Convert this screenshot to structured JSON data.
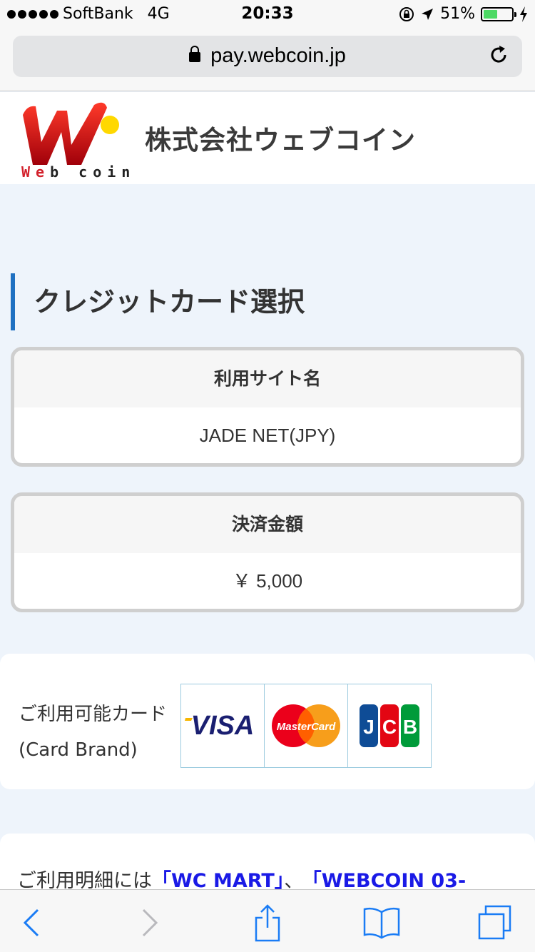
{
  "status_bar": {
    "carrier": "SoftBank",
    "network": "4G",
    "time": "20:33",
    "battery": "51%",
    "battery_level": 0.51
  },
  "browser": {
    "url": "pay.webcoin.jp"
  },
  "header": {
    "logo_text_red": "We",
    "logo_text_rest": "b coin",
    "company_name": "株式会社ウェブコイン"
  },
  "page": {
    "title": "クレジットカード選択"
  },
  "site_box": {
    "label": "利用サイト名",
    "value": "JADE NET(JPY)"
  },
  "amount_box": {
    "label": "決済金額",
    "value": "￥ 5,000"
  },
  "cards": {
    "label_jp": "ご利用可能カード",
    "label_en": "(Card Brand)",
    "brands": [
      "VISA",
      "MasterCard",
      "JCB"
    ]
  },
  "notice": {
    "prefix": "ご利用明細には",
    "highlight1": "「WC MART」",
    "separator": "、",
    "highlight2": "「WEBCOIN 03-"
  },
  "colors": {
    "accent": "#1f70c1",
    "link": "#1a1ae6",
    "background": "#eef4fb"
  }
}
